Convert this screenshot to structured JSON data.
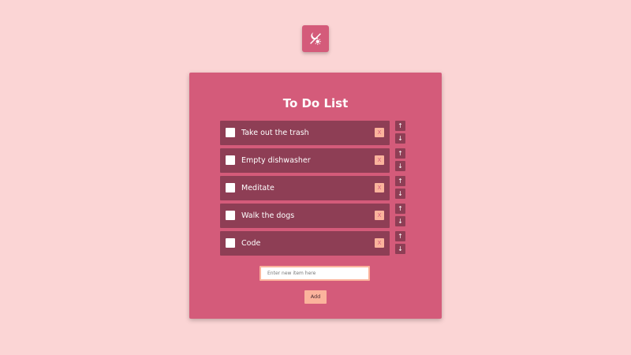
{
  "theme_toggle": {
    "icon": "day-night-toggle-icon"
  },
  "title": "To Do List",
  "todos": [
    {
      "text": "Take out the trash",
      "checked": false
    },
    {
      "text": "Empty dishwasher",
      "checked": false
    },
    {
      "text": "Meditate",
      "checked": false
    },
    {
      "text": "Walk the dogs",
      "checked": false
    },
    {
      "text": "Code",
      "checked": false
    }
  ],
  "item_controls": {
    "delete_label": "X",
    "up_label": "↑",
    "down_label": "↓"
  },
  "new_item": {
    "placeholder": "Enter new item here",
    "value": ""
  },
  "add_label": "Add",
  "colors": {
    "page_bg": "#fbd5d5",
    "card_bg": "#d45b7a",
    "item_bg": "#8e3e55",
    "accent": "#fbb39c"
  }
}
